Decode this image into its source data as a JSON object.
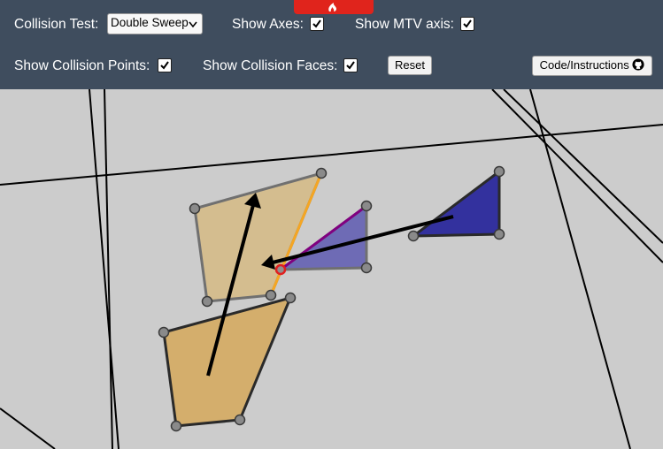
{
  "toolbar": {
    "collision_test_label": "Collision Test:",
    "collision_test_value": "Double Sweep",
    "show_axes_label": "Show Axes:",
    "show_mtv_axis_label": "Show MTV axis:",
    "show_collision_points_label": "Show Collision Points:",
    "show_collision_faces_label": "Show Collision Faces:",
    "reset_label": "Reset",
    "code_label": "Code/Instructions",
    "checkboxes": {
      "show_axes": true,
      "show_mtv_axis": true,
      "show_collision_points": true,
      "show_collision_faces": true
    }
  },
  "colors": {
    "toolbar_bg": "#3f4d5e",
    "canvas_bg": "#cccccc",
    "tan_ghost": "#d4bd8f",
    "tan_solid": "#d4ae6c",
    "blue_ghost": "#6e6bb5",
    "blue_solid": "#33319e",
    "collision_face": "#f5a623",
    "mtv_axis": "#800080",
    "collision_point": "#e02020"
  },
  "icons": {
    "brand": "github-icon",
    "top_tab": "fire-icon"
  }
}
